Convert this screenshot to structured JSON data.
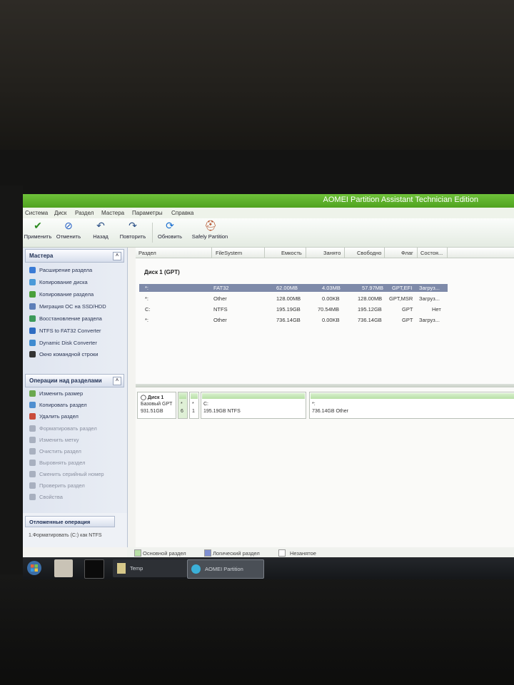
{
  "window": {
    "title": "AOMEI Partition Assistant Technician Edition"
  },
  "menu": [
    "Система",
    "Диск",
    "Раздел",
    "Мастера",
    "Параметры",
    "Справка"
  ],
  "toolbar": [
    {
      "label": "Применить",
      "icon": "check-icon"
    },
    {
      "label": "Отменить",
      "icon": "discard-icon"
    },
    {
      "label": "Назад",
      "icon": "undo-icon"
    },
    {
      "label": "Повторить",
      "icon": "redo-icon"
    },
    {
      "label": "Обновить",
      "icon": "refresh-icon"
    },
    {
      "label": "Safely Partition",
      "icon": "safely-partition-icon"
    }
  ],
  "sidebar": {
    "wizards_title": "Мастера",
    "wizards": [
      "Расширение раздела",
      "Копирование диска",
      "Копирование раздела",
      "Миграция ОС на SSD/HDD",
      "Восстановление раздела",
      "NTFS to FAT32 Converter",
      "Dynamic Disk Converter",
      "Окно командной строки"
    ],
    "operations_title": "Операции над разделами",
    "operations": [
      "Изменить размер",
      "Копировать раздел",
      "Удалить раздел",
      "Форматировать раздел",
      "Изменить метку",
      "Очистить раздел",
      "Выровнять раздел",
      "Сменить серийный номер",
      "Проверить раздел",
      "Свойства"
    ],
    "pending_title": "Отложенные операция",
    "pending_ops": [
      "1.Форматировать (C:) как NTFS"
    ]
  },
  "table": {
    "columns": [
      "Раздел",
      "FileSystem",
      "Емкость",
      "Занято",
      "Свободно",
      "Флаг",
      "Состоя..."
    ],
    "disk_label": "Диск 1 (GPT)",
    "rows": [
      {
        "partition": "*:",
        "fs": "FAT32",
        "capacity": "62.00MB",
        "used": "4.03MB",
        "free": "57.97MB",
        "flag": "GPT,EFI",
        "status": "Загруз..."
      },
      {
        "partition": "*:",
        "fs": "Other",
        "capacity": "128.00MB",
        "used": "0.00KB",
        "free": "128.00MB",
        "flag": "GPT,MSR",
        "status": "Загруз..."
      },
      {
        "partition": "C:",
        "fs": "NTFS",
        "capacity": "195.19GB",
        "used": "70.54MB",
        "free": "195.12GB",
        "flag": "GPT",
        "status": "Нет"
      },
      {
        "partition": "*:",
        "fs": "Other",
        "capacity": "736.14GB",
        "used": "0.00KB",
        "free": "736.14GB",
        "flag": "GPT",
        "status": "Загруз..."
      }
    ]
  },
  "diskmap": {
    "disk_name": "Диск 1",
    "disk_type": "Базовый GPT",
    "disk_size": "931.51GB",
    "small1_label": "*",
    "small1_num": "6",
    "small2_label": "*",
    "small2_num": "1",
    "c_label": "C:",
    "c_desc": "195.19GB NTFS",
    "other_label": "*:",
    "other_desc": "736.14GB Other"
  },
  "legend": [
    "Основной раздел",
    "Логический раздел",
    "Незанятое"
  ],
  "taskbar": {
    "temp": "Temp",
    "aomei": "AOMEI Partition"
  },
  "colors": {
    "accent_green": "#4fa21f",
    "selection": "#7e8aa9",
    "partition_bar": "#b8e0a6"
  }
}
